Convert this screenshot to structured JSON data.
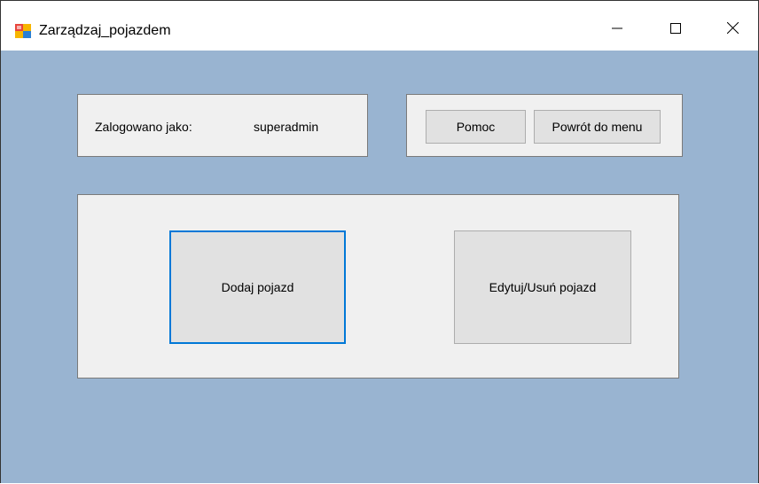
{
  "window": {
    "title": "Zarządzaj_pojazdem",
    "icon": "winforms-app-icon",
    "controls": {
      "minimize": "minimize-icon",
      "maximize": "maximize-icon",
      "close": "close-icon"
    }
  },
  "login_panel": {
    "label": "Zalogowano jako:",
    "username": "superadmin"
  },
  "nav_panel": {
    "help_label": "Pomoc",
    "back_label": "Powrót do menu"
  },
  "main_panel": {
    "add_vehicle_label": "Dodaj pojazd",
    "edit_vehicle_label": "Edytuj/Usuń pojazd"
  },
  "colors": {
    "form_background": "#99b4d1",
    "panel_background": "#f0f0f0",
    "button_background": "#e1e1e1",
    "focus_border": "#0078d7"
  }
}
